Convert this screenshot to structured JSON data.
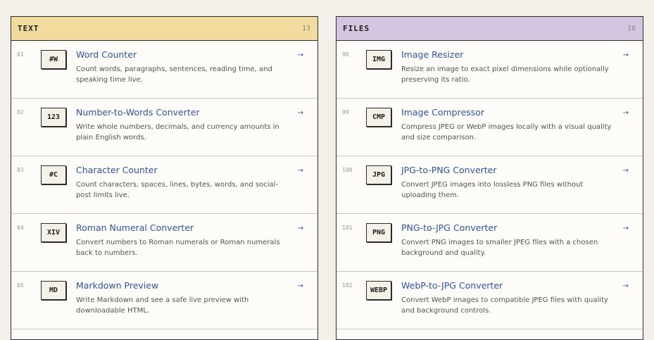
{
  "panels": [
    {
      "title": "TEXT",
      "count": "13",
      "color": "#f1dc9e",
      "tools": [
        {
          "num": "01",
          "badge": "#W",
          "title": "Word Counter",
          "desc": "Count words, paragraphs, sentences, reading time, and speaking time live.",
          "arrow": "→"
        },
        {
          "num": "02",
          "badge": "123",
          "title": "Number-to-Words Converter",
          "desc": "Write whole numbers, decimals, and currency amounts in plain English words.",
          "arrow": "→"
        },
        {
          "num": "03",
          "badge": "#C",
          "title": "Character Counter",
          "desc": "Count characters, spaces, lines, bytes, words, and social-post limits live.",
          "arrow": "→"
        },
        {
          "num": "04",
          "badge": "XIV",
          "title": "Roman Numeral Converter",
          "desc": "Convert numbers to Roman numerals or Roman numerals back to numbers.",
          "arrow": "→"
        },
        {
          "num": "05",
          "badge": "MD",
          "title": "Markdown Preview",
          "desc": "Write Markdown and see a safe live preview with downloadable HTML.",
          "arrow": "→"
        }
      ]
    },
    {
      "title": "FILES",
      "count": "16",
      "color": "#d4c6e0",
      "tools": [
        {
          "num": "98",
          "badge": "IMG",
          "title": "Image Resizer",
          "desc": "Resize an image to exact pixel dimensions while optionally preserving its ratio.",
          "arrow": "→"
        },
        {
          "num": "99",
          "badge": "CMP",
          "title": "Image Compressor",
          "desc": "Compress JPEG or WebP images locally with a visual quality and size comparison.",
          "arrow": "→"
        },
        {
          "num": "100",
          "badge": "JPG",
          "title": "JPG-to-PNG Converter",
          "desc": "Convert JPEG images into lossless PNG files without uploading them.",
          "arrow": "→"
        },
        {
          "num": "101",
          "badge": "PNG",
          "title": "PNG-to-JPG Converter",
          "desc": "Convert PNG images to smaller JPEG files with a chosen background and quality.",
          "arrow": "→"
        },
        {
          "num": "102",
          "badge": "WEBP",
          "title": "WebP-to-JPG Converter",
          "desc": "Convert WebP images to compatible JPEG files with quality and background controls.",
          "arrow": "→"
        }
      ]
    }
  ]
}
